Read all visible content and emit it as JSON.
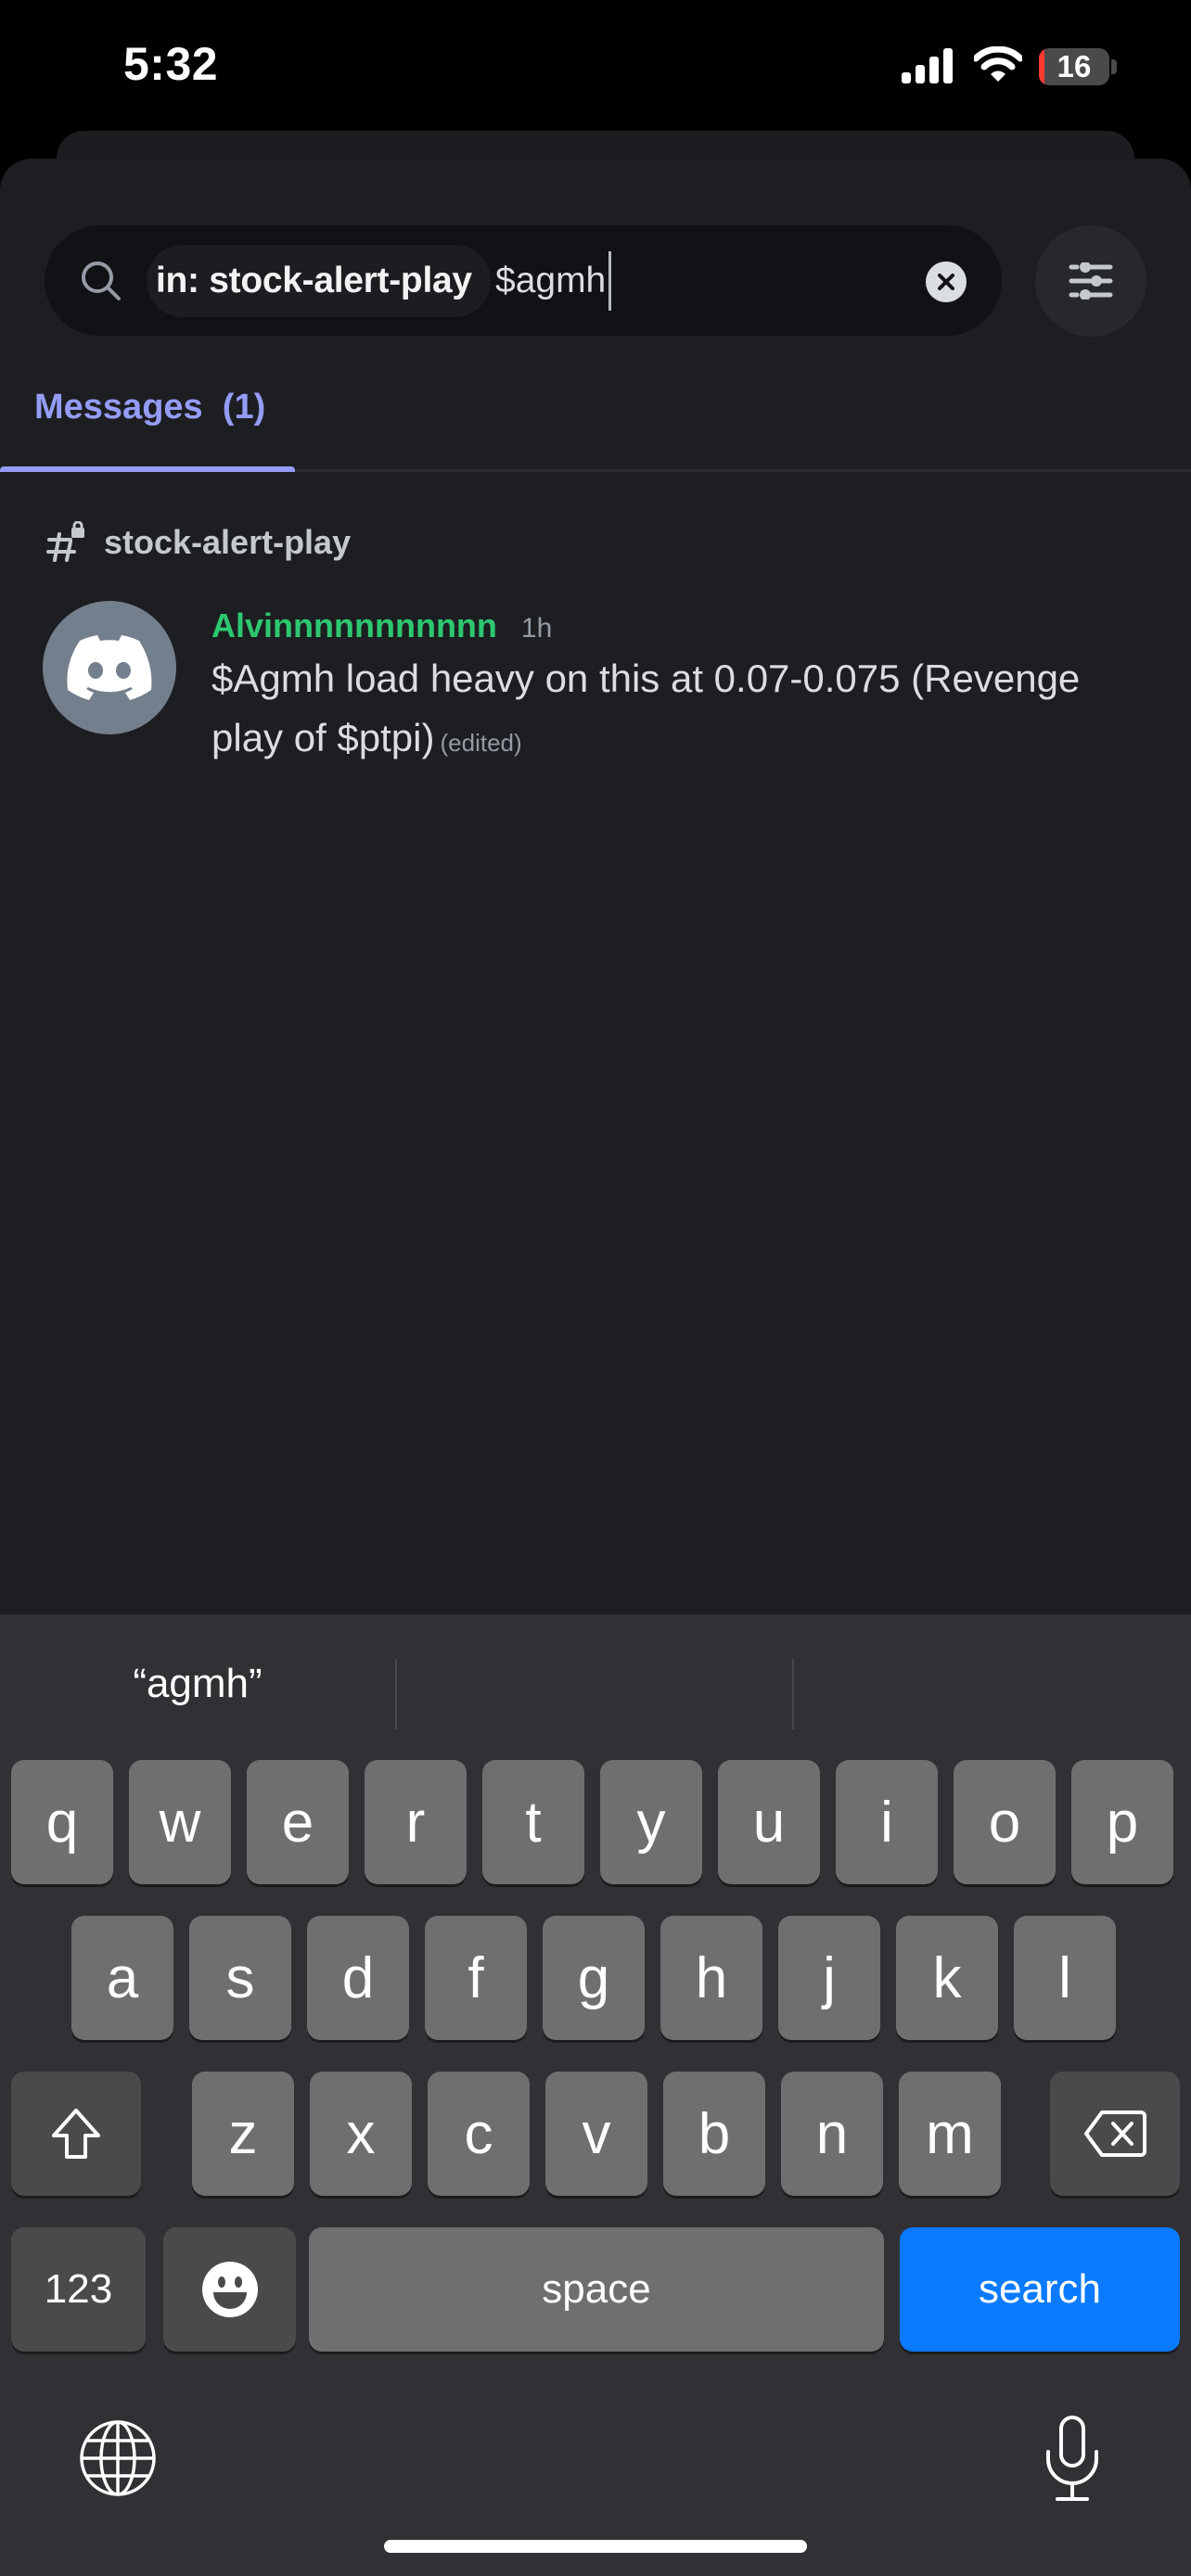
{
  "status_bar": {
    "time": "5:32",
    "battery_level": "16",
    "battery_fraction": 0.16,
    "battery_color": "#ff3b30"
  },
  "search": {
    "filter_chip": "in: stock-alert-play",
    "query": "$agmh",
    "icons": {
      "search": "search-icon",
      "clear": "clear-circle-x-icon",
      "filters": "sliders-icon"
    }
  },
  "tabs": [
    {
      "label": "Messages",
      "count": "(1)",
      "display": "Messages  (1)",
      "active": true
    }
  ],
  "results": {
    "channel": {
      "icon": "locked-hashtag-icon",
      "name": "stock-alert-play"
    },
    "messages": [
      {
        "avatar": "discord-logo-icon",
        "author": "Alvinnnnnnnnnnn",
        "author_color": "#2dc770",
        "timestamp": "1h",
        "text": "$Agmh load heavy on this at 0.07-0.075 (Revenge play of $ptpi)",
        "edited_label": "(edited)"
      }
    ]
  },
  "keyboard": {
    "predictions": [
      "“agmh”",
      "",
      ""
    ],
    "row1": [
      "q",
      "w",
      "e",
      "r",
      "t",
      "y",
      "u",
      "i",
      "o",
      "p"
    ],
    "row2": [
      "a",
      "s",
      "d",
      "f",
      "g",
      "h",
      "j",
      "k",
      "l"
    ],
    "row3": [
      "z",
      "x",
      "c",
      "v",
      "b",
      "n",
      "m"
    ],
    "numbers_label": "123",
    "space_label": "space",
    "return_label": "search",
    "return_color": "#0a7aff",
    "icons": {
      "shift": "shift-icon",
      "delete": "backspace-icon",
      "emoji": "emoji-icon",
      "globe": "globe-icon",
      "mic": "microphone-icon"
    }
  }
}
